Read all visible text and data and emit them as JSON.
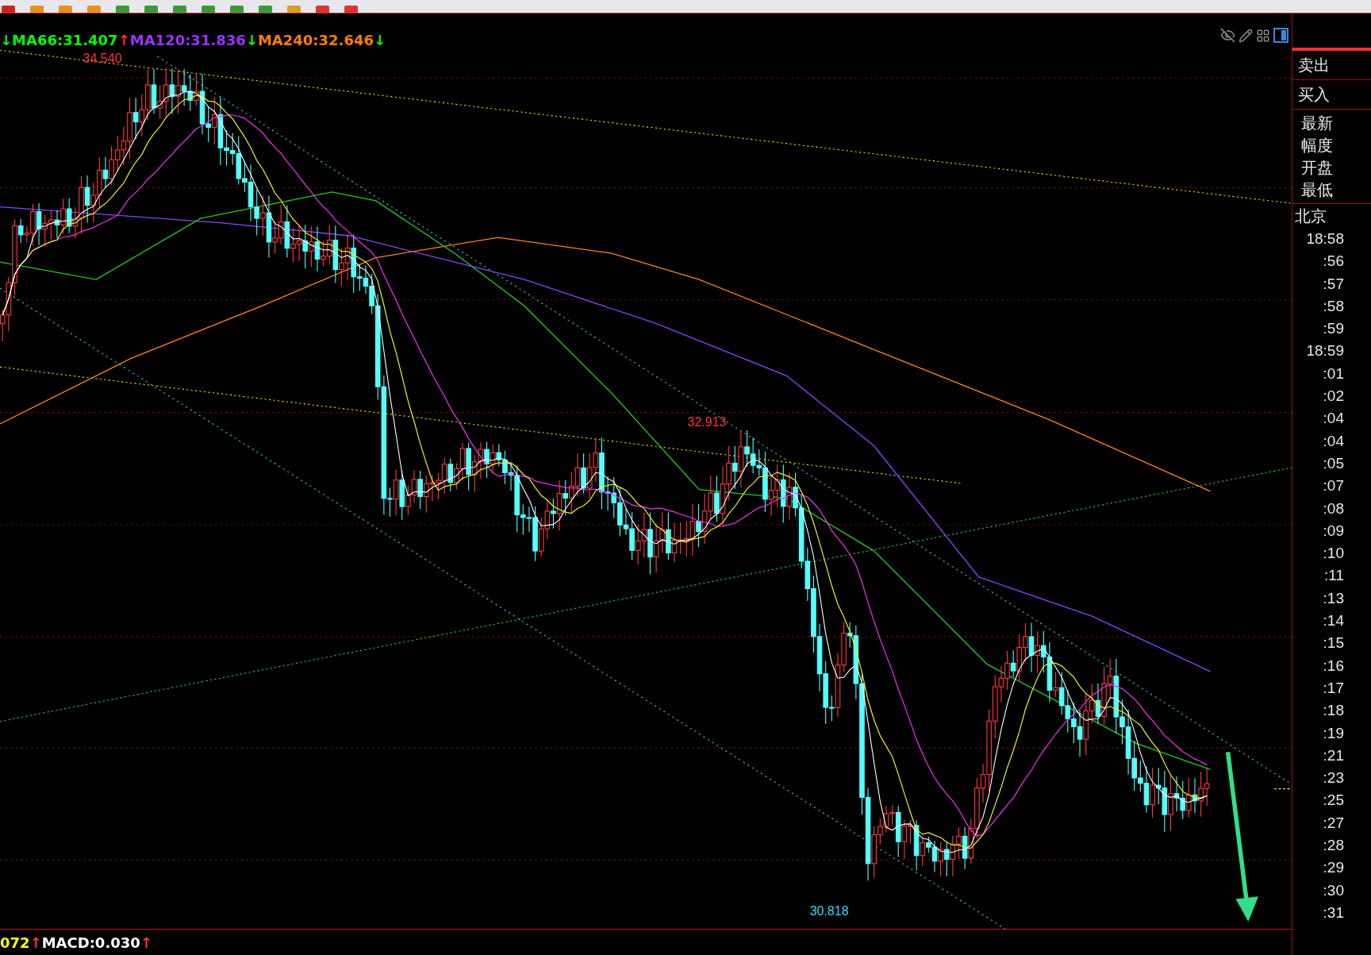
{
  "legend": [
    {
      "text": "↓",
      "color": "#00ff00"
    },
    {
      "text": "MA66:31.407",
      "color": "#00ff00"
    },
    {
      "text": "↑",
      "color": "#ff3030"
    },
    {
      "text": "MA120:31.836",
      "color": "#9933ff"
    },
    {
      "text": "↓",
      "color": "#00ff00"
    },
    {
      "text": "MA240:32.646",
      "color": "#ff7f00"
    },
    {
      "text": "↓",
      "color": "#00ff00"
    }
  ],
  "chart_labels": [
    {
      "text": "34.540",
      "color": "#ff3333"
    },
    {
      "text": "32.913",
      "color": "#ff3333"
    },
    {
      "text": "30.818",
      "color": "#33ddff"
    }
  ],
  "side_panel": {
    "buttons": [
      "卖出",
      "买入"
    ],
    "fields": [
      "最新",
      "幅度",
      "开盘",
      "最低"
    ],
    "timezone": "北京",
    "times": [
      "18:58",
      ":56",
      ":57",
      ":58",
      ":59",
      "18:59",
      ":01",
      ":02",
      ":04",
      ":04",
      ":05",
      ":07",
      ":08",
      ":09",
      ":10",
      ":11",
      ":13",
      ":14",
      ":15",
      ":16",
      ":17",
      ":18",
      ":19",
      ":21",
      ":23",
      ":25",
      ":27",
      ":28",
      ":29",
      ":30",
      ":31"
    ]
  },
  "macd_legend": [
    {
      "text": "072",
      "color": "#ffff00"
    },
    {
      "text": "↑",
      "color": "#ff3030"
    },
    {
      "text": "MACD:0.030",
      "color": "#ffffff"
    },
    {
      "text": "↑",
      "color": "#ff3030"
    }
  ]
}
